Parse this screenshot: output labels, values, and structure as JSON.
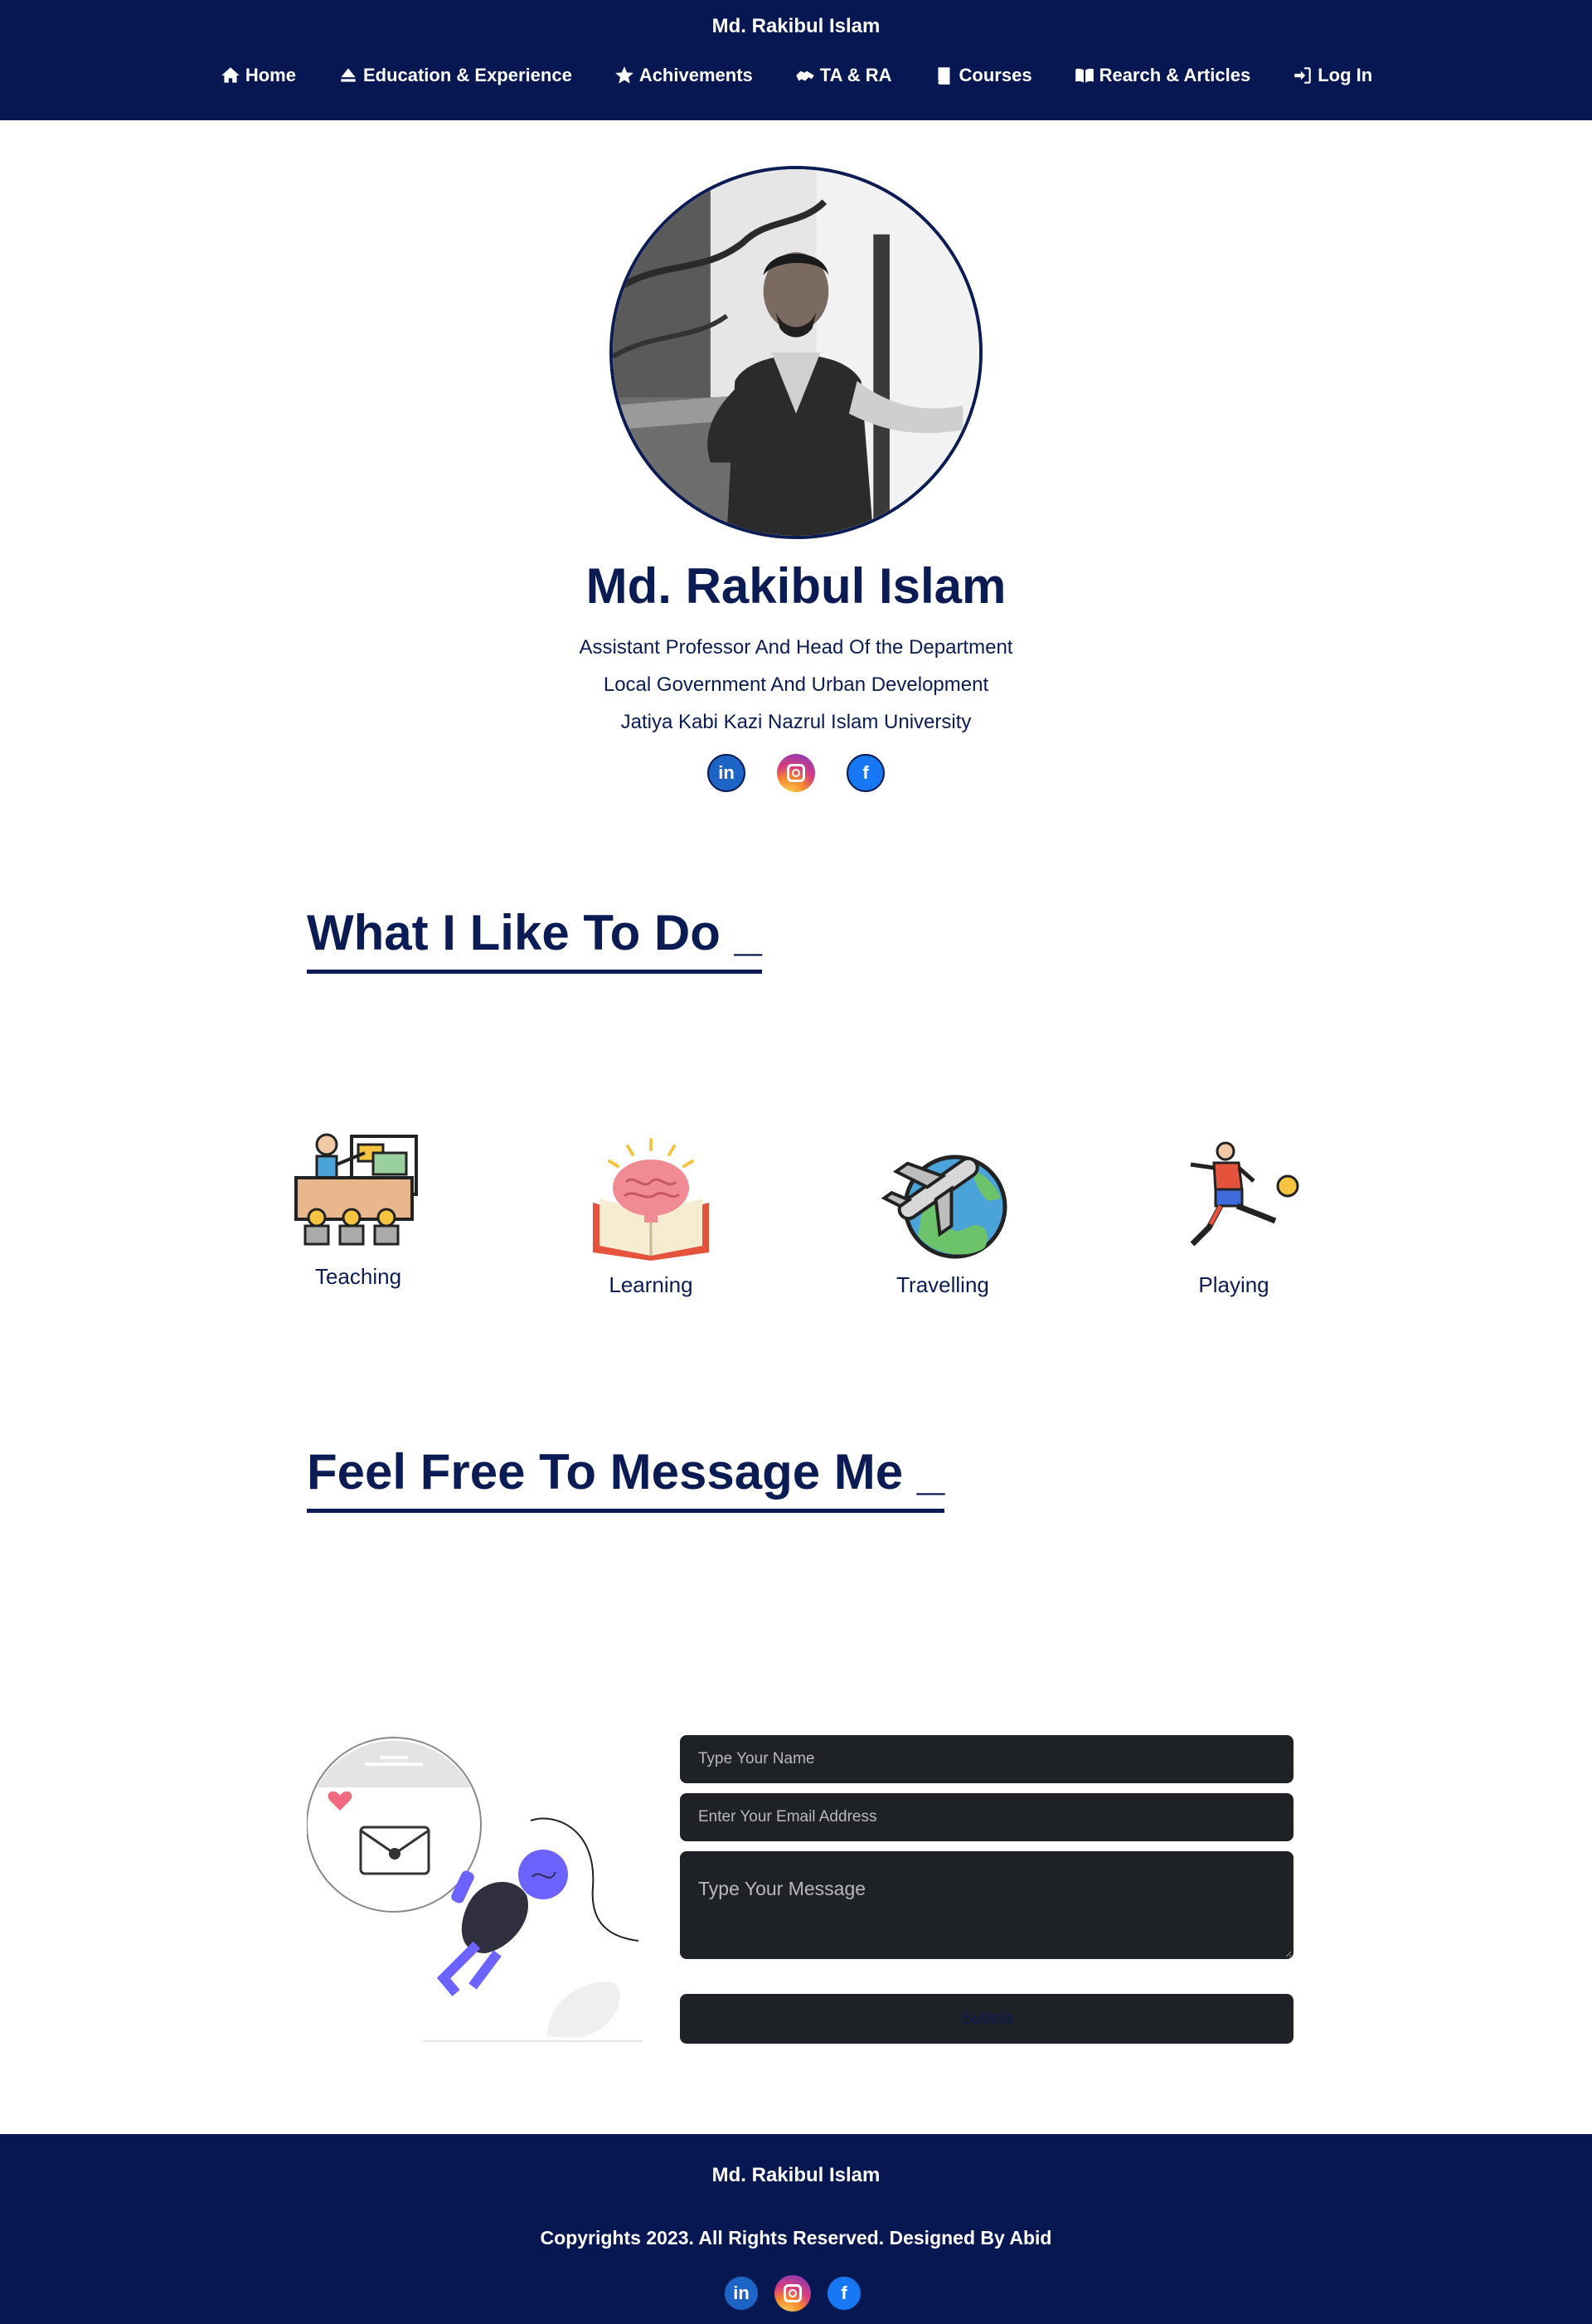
{
  "header": {
    "brand": "Md. Rakibul Islam",
    "nav": [
      {
        "label": "Home",
        "icon": "home-icon"
      },
      {
        "label": "Education & Experience",
        "icon": "eject-icon"
      },
      {
        "label": "Achivements",
        "icon": "star-icon"
      },
      {
        "label": "TA & RA",
        "icon": "handshake-icon"
      },
      {
        "label": "Courses",
        "icon": "book-icon"
      },
      {
        "label": "Rearch & Articles",
        "icon": "open-book-icon"
      },
      {
        "label": "Log In",
        "icon": "login-icon"
      }
    ]
  },
  "profile": {
    "name": "Md. Rakibul Islam",
    "title": "Assistant Professor And Head Of the Department",
    "department": "Local Government And Urban Development",
    "university": "Jatiya Kabi Kazi Nazrul Islam University",
    "social": [
      {
        "name": "linkedin-icon",
        "glyph": "in",
        "color": "#1c64c5"
      },
      {
        "name": "instagram-icon",
        "glyph": "",
        "color": "#d93d7d"
      },
      {
        "name": "facebook-icon",
        "glyph": "f",
        "color": "#1877f2"
      }
    ]
  },
  "hobbies": {
    "title": "What I Like To Do _",
    "items": [
      {
        "label": "Teaching",
        "icon": "teaching-icon"
      },
      {
        "label": "Learning",
        "icon": "learning-icon"
      },
      {
        "label": "Travelling",
        "icon": "travelling-icon"
      },
      {
        "label": "Playing",
        "icon": "playing-icon"
      }
    ]
  },
  "contact": {
    "title": "Feel Free To Message Me _",
    "name_placeholder": "Type Your Name",
    "email_placeholder": "Enter Your Email Address",
    "message_placeholder": "Type Your Message",
    "submit_label": "Submit"
  },
  "footer": {
    "brand": "Md. Rakibul Islam",
    "copyright": "Copyrights 2023. All Rights Reserved. Designed By Abid"
  },
  "colors": {
    "navy": "#071752",
    "text": "#0b1b53",
    "field": "#1e2126"
  }
}
